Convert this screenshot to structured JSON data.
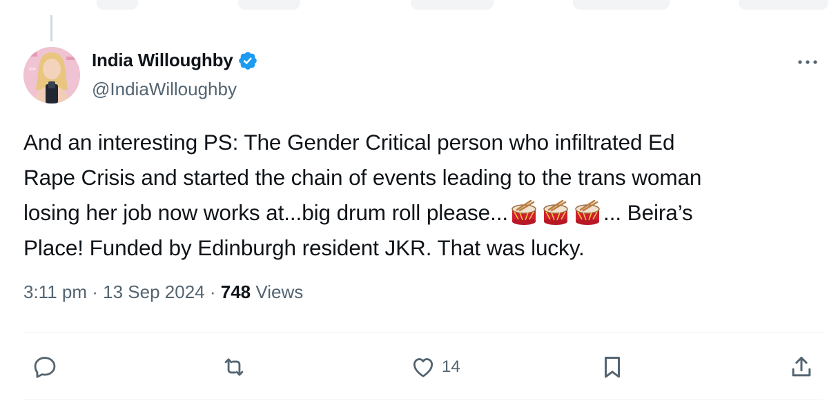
{
  "tweet": {
    "author": {
      "display_name": "India Willoughby",
      "handle": "@IndiaWilloughby",
      "verified": true
    },
    "text": {
      "line1": "And an interesting PS: The Gender Critical person who infiltrated Ed",
      "line2": "Rape Crisis and started the chain of events leading to the trans woman",
      "line3_pre": "losing her job now works at...big drum roll please...",
      "line3_post": "... Beira’s",
      "line4": "Place! Funded by Edinburgh resident JKR.  That was lucky."
    },
    "meta": {
      "time": "3:11 pm",
      "date": "13 Sep 2024",
      "separator": "·",
      "views_count": "748",
      "views_label": "Views"
    },
    "actions": {
      "likes": "14"
    }
  },
  "icons": {
    "avatar": "profile-photo",
    "verified": "verified-badge-icon",
    "more": "more-options-icon",
    "drum": "drum-emoji",
    "reply": "reply-icon",
    "repost": "repost-icon",
    "like": "heart-icon",
    "bookmark": "bookmark-icon",
    "share": "share-icon"
  },
  "colors": {
    "text_primary": "#0f1419",
    "text_secondary": "#536471",
    "verified_blue": "#1d9bf0",
    "divider": "#eff3f4"
  }
}
